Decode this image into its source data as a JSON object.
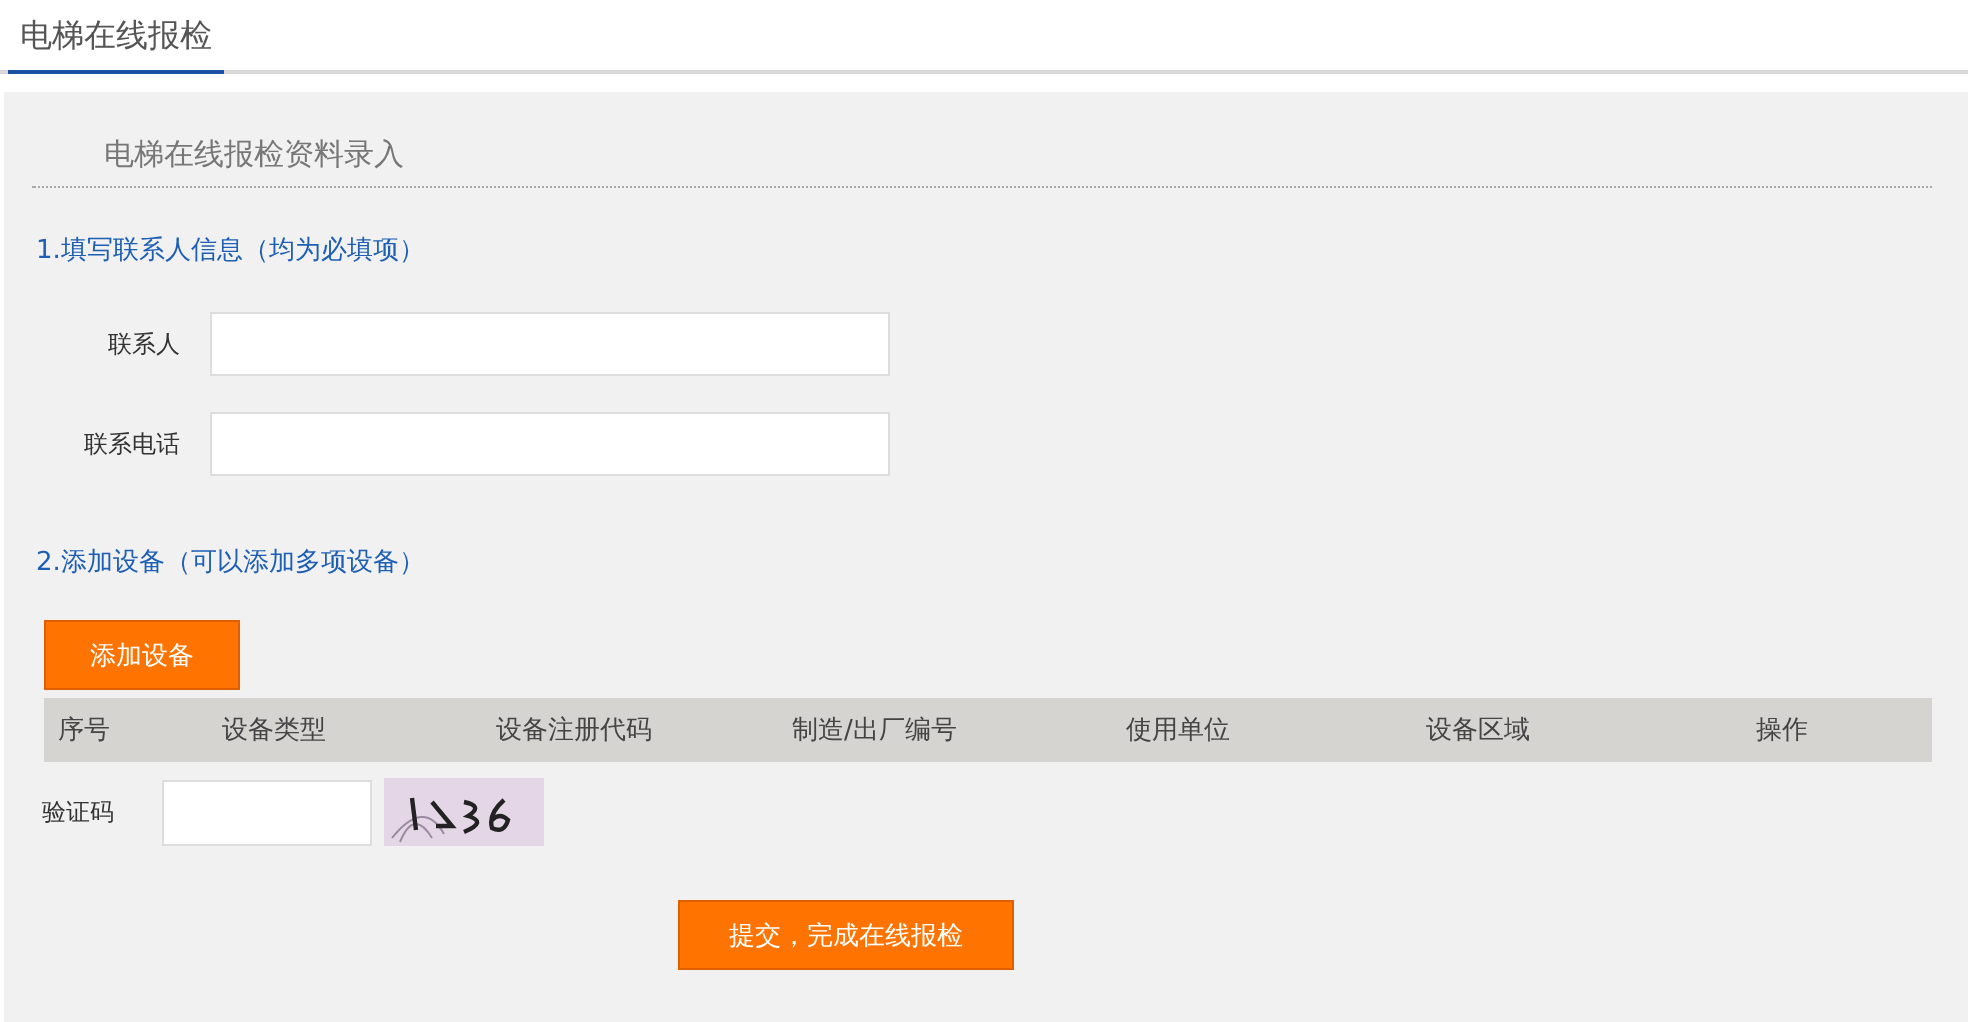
{
  "tab": {
    "label": "电梯在线报检",
    "selected": true
  },
  "page_title": "电梯在线报检资料录入",
  "section_1": {
    "title": "1.填写联系人信息（均为必填项）",
    "fields": [
      {
        "label": "联系人"
      },
      {
        "label": "联系电话"
      }
    ]
  },
  "section_2": {
    "title": "2.添加设备（可以添加多项设备）",
    "add_button": "添加设备",
    "table": {
      "columns": [
        "序号",
        "设备类型",
        "设备注册代码",
        "制造/出厂编号",
        "使用单位",
        "设备区域",
        "操作"
      ]
    }
  },
  "captcha": {
    "label": "验证码"
  },
  "submit_button": "提交，完成在线报检"
}
